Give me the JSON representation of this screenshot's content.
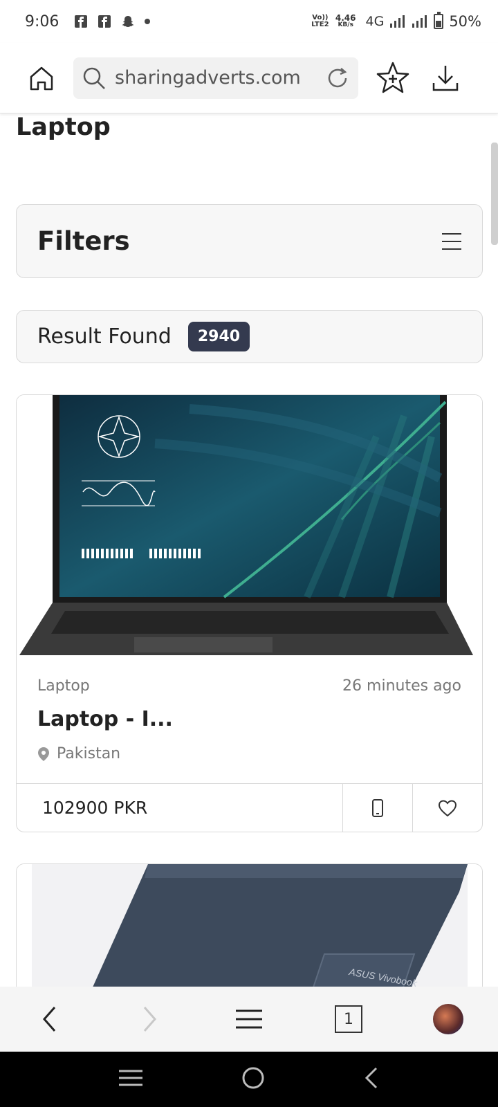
{
  "status_bar": {
    "time": "9:06",
    "lte": "Vo)) LTE2",
    "speed_value": "4.46",
    "speed_unit": "KB/s",
    "network": "4G",
    "battery": "50%"
  },
  "browser": {
    "url": "sharingadverts.com"
  },
  "page": {
    "title": "Laptop",
    "filters_title": "Filters",
    "result_label": "Result Found",
    "result_count": "2940"
  },
  "listings": [
    {
      "category": "Laptop",
      "time_ago": "26 minutes ago",
      "title": "Laptop - I...",
      "location": "Pakistan",
      "price": "102900 PKR"
    },
    {
      "image_label": "ASUS Vivobook"
    }
  ],
  "bottom_nav": {
    "tab_count": "1"
  },
  "colors": {
    "badge_bg": "#343a4f",
    "accent_text": "#222222",
    "muted_text": "#777777"
  }
}
